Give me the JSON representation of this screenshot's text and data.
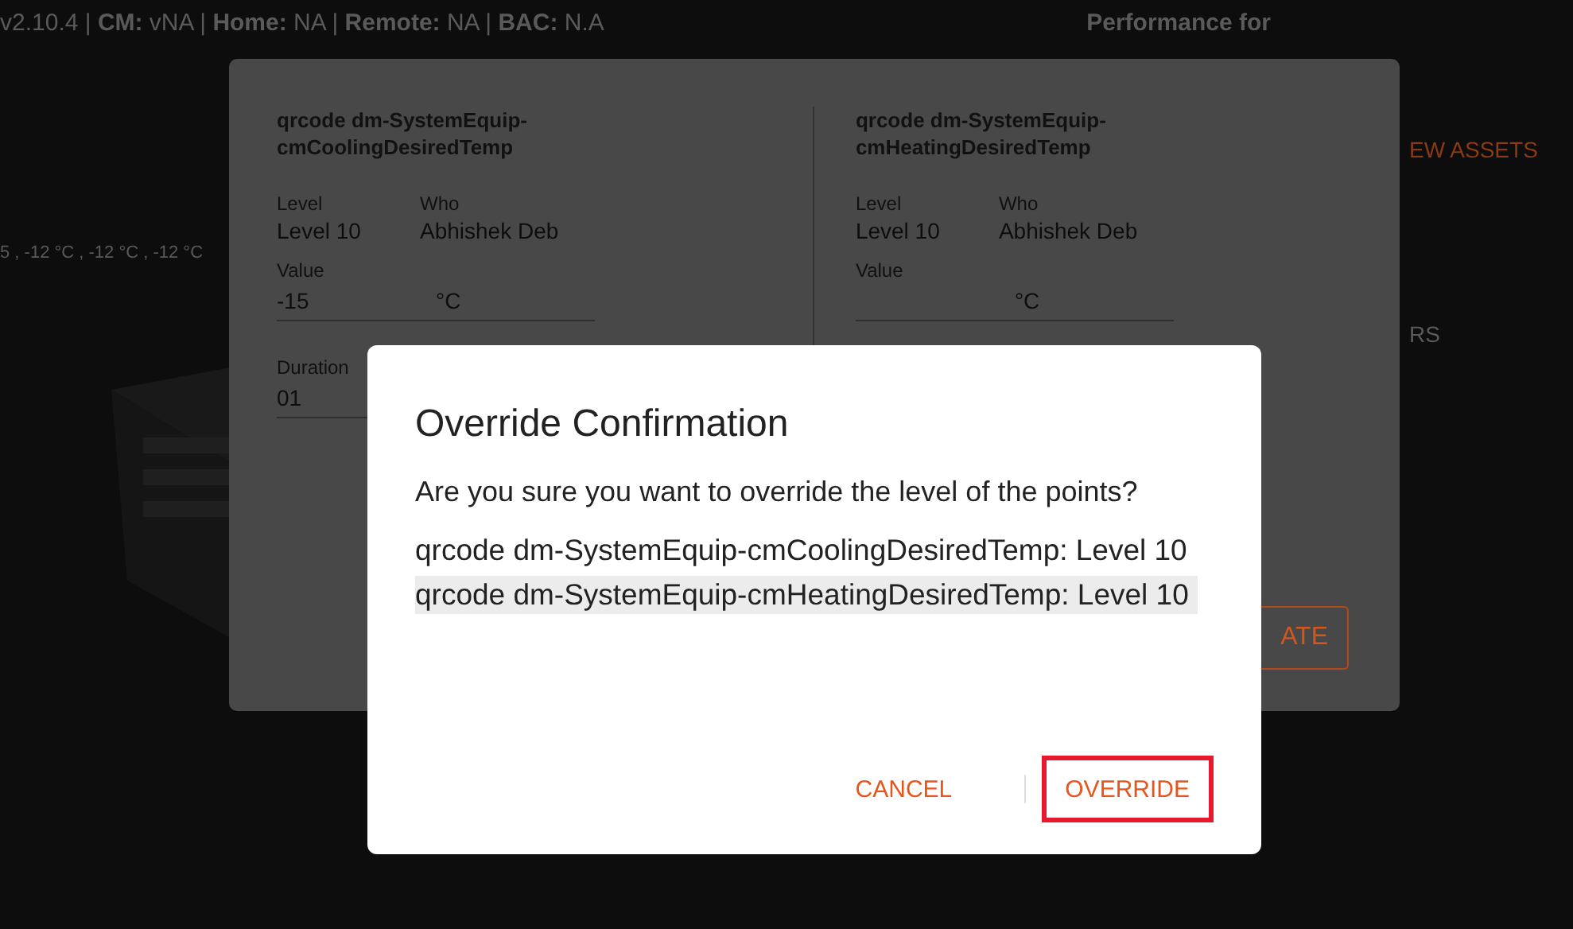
{
  "header": {
    "status": "v2.10.4 | **CM:** vNA | **Home:** NA | **Remote:** NA | **BAC:** N.A",
    "performance_label": "Performance for"
  },
  "background": {
    "readings": "5 , -12 °C , -12 °C , -12 °C",
    "link": "EW ASSETS",
    "label": "RS",
    "kind": "picture"
  },
  "panel": {
    "points": [
      {
        "title": "qrcode dm-SystemEquip-cmCoolingDesiredTemp",
        "level_label": "Level",
        "level_value": "Level 10",
        "who_label": "Who",
        "who": "Abhishek Deb",
        "value_label": "Value",
        "value": "-15",
        "unit": "°C",
        "duration_label": "Duration",
        "duration": "01"
      },
      {
        "title": "qrcode dm-SystemEquip-cmHeatingDesiredTemp",
        "level_label": "Level",
        "level_value": "Level 10",
        "who_label": "Who",
        "who": "Abhishek Deb",
        "value_label": "Value",
        "unit": "°C"
      }
    ],
    "button": "ATE"
  },
  "dialog": {
    "title": "Override Confirmation",
    "message": "Are you sure you want to override the level of the points?",
    "items": [
      {
        "text": "qrcode dm-SystemEquip-cmCoolingDesiredTemp: Level 10",
        "highlighted": false
      },
      {
        "text": "qrcode dm-SystemEquip-cmHeatingDesiredTemp: Level 10",
        "highlighted": true
      }
    ],
    "buttons": [
      {
        "label": "CANCEL",
        "highlighted": false
      },
      {
        "label": "OVERRIDE",
        "highlighted": true
      }
    ]
  }
}
